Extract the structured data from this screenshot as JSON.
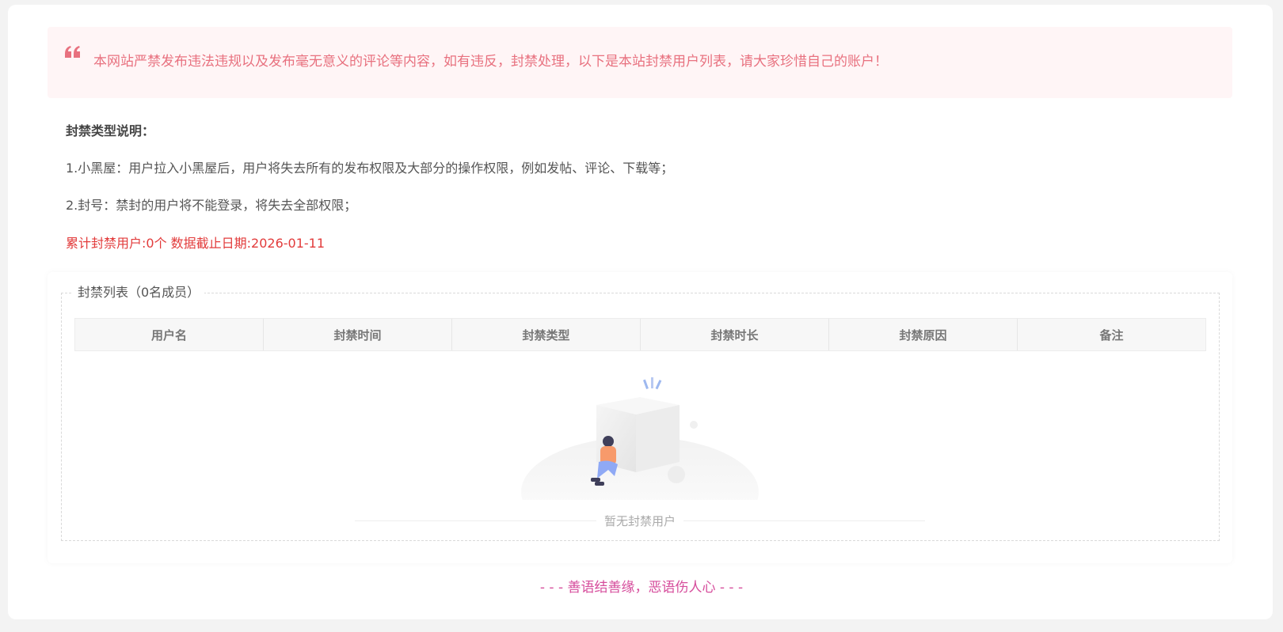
{
  "notice": {
    "text": "本网站严禁发布违法违规以及发布毫无意义的评论等内容，如有违反，封禁处理，以下是本站封禁用户列表，请大家珍惜自己的账户！"
  },
  "info": {
    "title": "封禁类型说明：",
    "item1": "1.小黑屋：用户拉入小黑屋后，用户将失去所有的发布权限及大部分的操作权限，例如发帖、评论、下载等；",
    "item2": "2.封号：禁封的用户将不能登录，将失去全部权限；",
    "stats": "累计封禁用户:0个 数据截止日期:2026-01-11"
  },
  "ban_list": {
    "legend": "封禁列表（0名成员）",
    "columns": [
      "用户名",
      "封禁时间",
      "封禁类型",
      "封禁时长",
      "封禁原因",
      "备注"
    ],
    "empty_text": "暂无封禁用户"
  },
  "footer": {
    "slogan": "- - - 善语结善缘，恶语伤人心 - - -"
  },
  "colors": {
    "notice_bg": "#fff5f6",
    "notice_text": "#e8717f",
    "stats_text": "#e23b3b",
    "slogan_text": "#d64d9c"
  }
}
